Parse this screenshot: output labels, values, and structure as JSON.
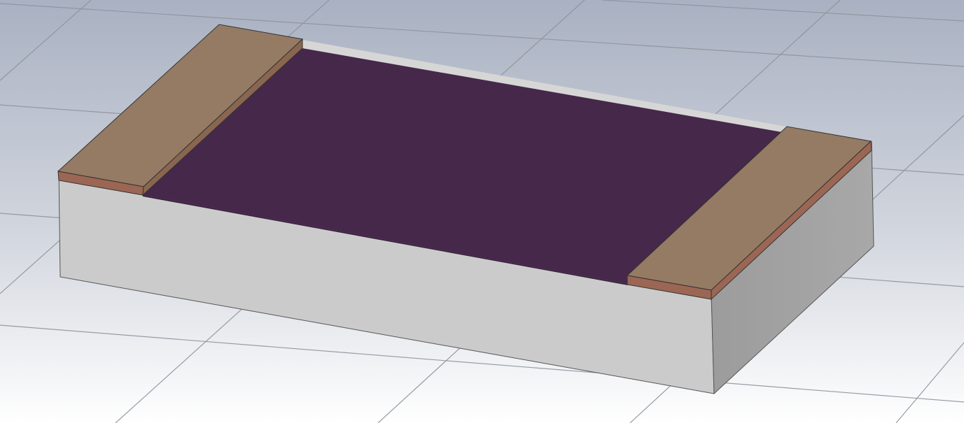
{
  "scene": {
    "background": {
      "top_color": "#a9b1c2",
      "bottom_color": "#ffffff"
    },
    "grid": {
      "visible": true,
      "line_color": "#8e939c"
    },
    "model": {
      "substrate": {
        "top_color": "#d6d6d6",
        "front_color": "#cbcbcb",
        "side_color": "#a4a4a4"
      },
      "resistive_layer": {
        "color": "#45284a",
        "edge_color": "#3a1f3e"
      },
      "terminals": {
        "count": 2,
        "top_color": "#957b64",
        "edge_color": "#9c6654"
      }
    }
  }
}
